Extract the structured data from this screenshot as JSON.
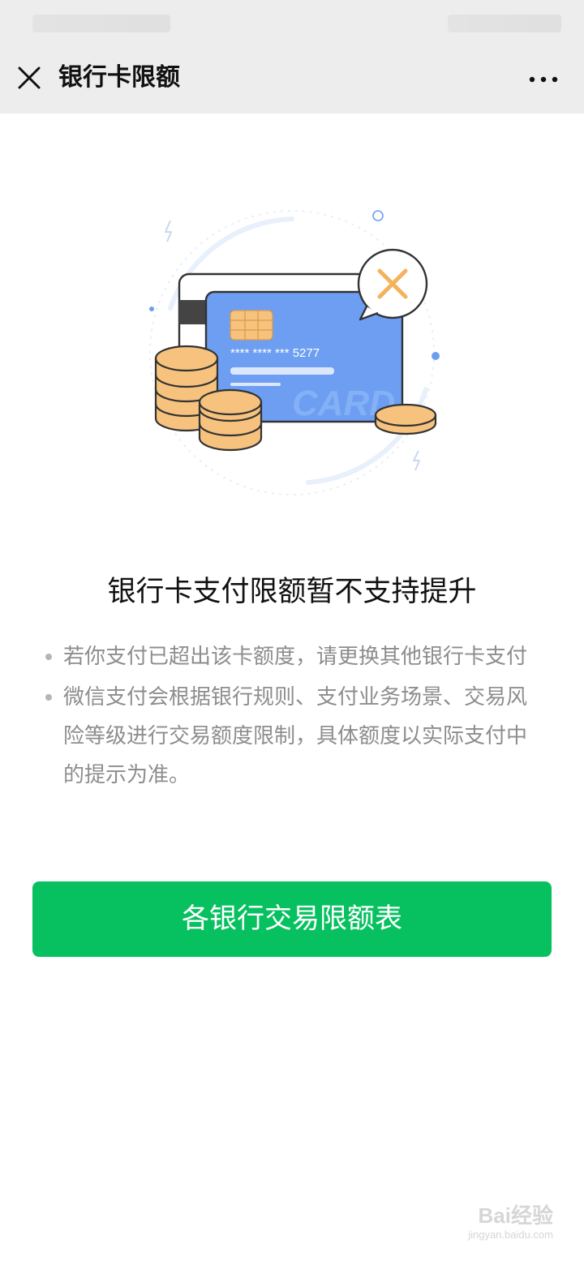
{
  "statusbar": {
    "left_text": "",
    "right_text": ""
  },
  "navbar": {
    "title": "银行卡限额",
    "close_icon": "close-icon",
    "more_icon": "more-icon"
  },
  "illustration": {
    "card_number": "****  ****  ***  5277",
    "card_word": "CARD",
    "x_icon": "x-icon",
    "colors": {
      "card_blue": "#6d9ef2",
      "coin_orange": "#f7c27e",
      "x_orange": "#f4b25b"
    }
  },
  "headline": "银行卡支付限额暂不支持提升",
  "notes": [
    "若你支付已超出该卡额度，请更换其他银行卡支付",
    "微信支付会根据银行规则、支付业务场景、交易风险等级进行交易额度限制，具体额度以实际支付中的提示为准。"
  ],
  "primary_button": {
    "label": "各银行交易限额表",
    "color": "#07c160"
  },
  "watermark": {
    "main": "Bai经验",
    "sub": "jingyan.baidu.com"
  }
}
